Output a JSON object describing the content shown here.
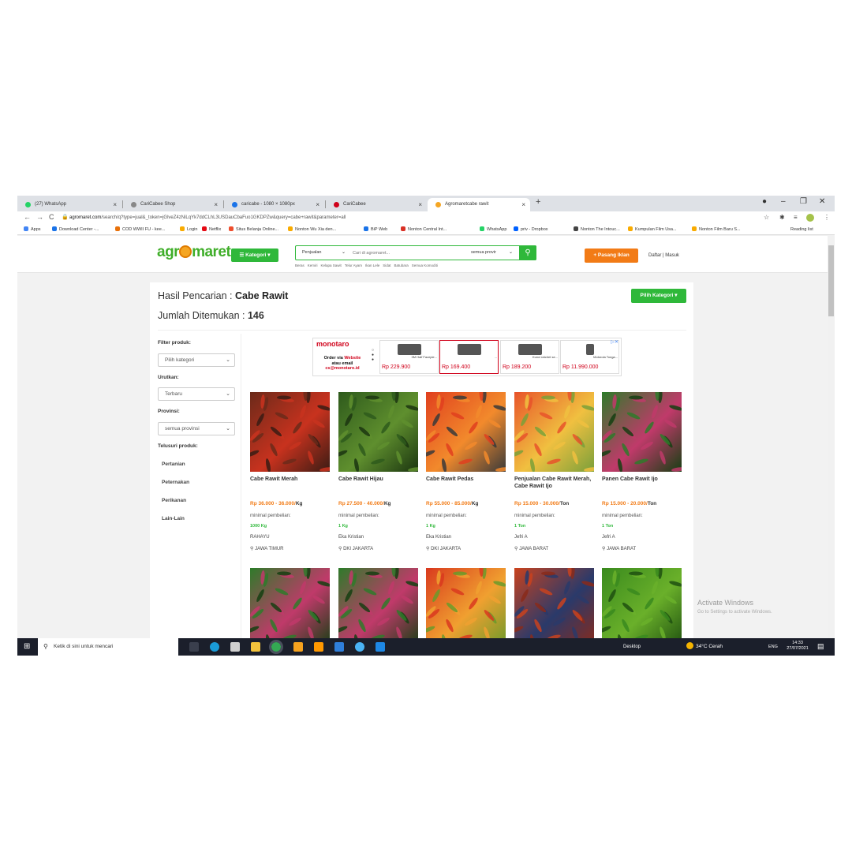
{
  "browser": {
    "tabs": [
      {
        "label": "(27) WhatsApp",
        "color": "#25d366"
      },
      {
        "label": "CariCabee Shop",
        "color": "#888888"
      },
      {
        "label": "caricabe - 1080 × 1080px",
        "color": "#1a73e8"
      },
      {
        "label": "CariCabee",
        "color": "#d0021b"
      },
      {
        "label": "Agromaretcabe rawit",
        "color": "#f5a623"
      }
    ],
    "url_domain": "agromaret.com",
    "url_path": "/search/q?type=jual&_token=jGlveZ4zNiLqYk7ddCLhL3USDauCbaFuo1GKDPZw&query=cabe+rawit&parameter=all",
    "bookmarks": [
      {
        "label": "Apps",
        "color": "#4285f4"
      },
      {
        "label": "Download Center -...",
        "color": "#1a73e8"
      },
      {
        "label": "COD WWII FU - kee...",
        "color": "#e8710a"
      },
      {
        "label": "Login",
        "color": "#f9ab00"
      },
      {
        "label": "Netflix",
        "color": "#e50914"
      },
      {
        "label": "Situs Belanja Online...",
        "color": "#ee4d2d"
      },
      {
        "label": "Nonton Wu Xia den...",
        "color": "#f9ab00"
      },
      {
        "label": "BiP Web",
        "color": "#1a73e8"
      },
      {
        "label": "Nonton Central Int...",
        "color": "#d93025"
      },
      {
        "label": "WhatsApp",
        "color": "#25d366"
      },
      {
        "label": "priv - Dropbox",
        "color": "#0061ff"
      },
      {
        "label": "Nonton The Intouc...",
        "color": "#444444"
      },
      {
        "label": "Kumpulan Film Usa...",
        "color": "#f9ab00"
      },
      {
        "label": "Nonton Film Baru S...",
        "color": "#f9ab00"
      }
    ],
    "reading_list": "Reading list"
  },
  "site": {
    "logo": "agr",
    "logo_rest": "maret",
    "kategori_btn": "☰ Kategori ▾",
    "search_type": "Penjualan",
    "search_placeholder": "Cari di agromaret...",
    "province": "semua provir",
    "quick_links": [
      "Beras",
      "Kemiri",
      "Kelapa Sawit",
      "Telur Ayam",
      "Ikan Lele",
      "Sidat",
      "Batubara",
      "Semua Komoditi"
    ],
    "pasang_btn": "+ Pasang Iklan",
    "auth": "Daftar | Masuk"
  },
  "results": {
    "title_prefix": "Hasil Pencarian : ",
    "query": "Cabe Rawit",
    "count_prefix": "Jumlah Ditemukan : ",
    "count": "146",
    "pilih_btn": "Pilih Kategori ▾"
  },
  "filters": {
    "filter_label": "Filter produk:",
    "filter_value": "Pilih kategori",
    "sort_label": "Urutkan:",
    "sort_value": "Terbaru",
    "province_label": "Provinsi:",
    "province_value": "semua provinsi",
    "browse_label": "Telusuri produk:",
    "categories": [
      "Pertanian",
      "Peternakan",
      "Perikanan",
      "Lain-Lain"
    ]
  },
  "ad": {
    "brand": "monotaro",
    "order_line1": "Order via",
    "order_web": "Website",
    "order_line2": "atau email",
    "order_email": "cs@monotaro.id",
    "items": [
      {
        "name": "3M Half Facepie...",
        "price": "Rp 229.900"
      },
      {
        "name": "...",
        "price": "Rp 169.400"
      },
      {
        "name": "Kunci ratchet se...",
        "price": "Rp 189.200"
      },
      {
        "name": "Motorola Tonga...",
        "price": "Rp 11.990.000"
      }
    ]
  },
  "products": [
    {
      "name": "Cabe Rawit Merah",
      "price": "Rp 36.000 - 36.000/",
      "unit": "Kg",
      "min_label": "minimal pembelian:",
      "min": "1000 Kg",
      "seller": "RAHAYU",
      "location": "JAWA TIMUR",
      "colors": [
        "#6b2a1a",
        "#c8321e",
        "#3a1c14"
      ]
    },
    {
      "name": "Cabe Rawit Hijau",
      "price": "Rp 27.500 - 40.000/",
      "unit": "Kg",
      "min_label": "minimal pembelian:",
      "min": "1 Kg",
      "seller": "Eka Kristian",
      "location": "DKI JAKARTA",
      "colors": [
        "#2e5a1c",
        "#5f8f2e",
        "#1b3510"
      ]
    },
    {
      "name": "Cabe Rawit Pedas",
      "price": "Rp 55.000 - 85.000/",
      "unit": "Kg",
      "min_label": "minimal pembelian:",
      "min": "1 Kg",
      "seller": "Eka Kristian",
      "location": "DKI JAKARTA",
      "colors": [
        "#e0401e",
        "#f28a2c",
        "#3a3a3a"
      ]
    },
    {
      "name": "Penjualan Cabe Rawit Merah, Cabe Rawit Ijo",
      "price": "Rp 15.000 - 30.000/",
      "unit": "Ton",
      "min_label": "minimal pembelian:",
      "min": "1 Ton",
      "seller": "Jefri A",
      "location": "JAWA BARAT",
      "colors": [
        "#e8542a",
        "#f0c040",
        "#7aa03a"
      ]
    },
    {
      "name": "Panen Cabe Rawit Ijo",
      "price": "Rp 15.000 - 20.000/",
      "unit": "Ton",
      "min_label": "minimal pembelian:",
      "min": "1 Ton",
      "seller": "Jefri A",
      "location": "JAWA BARAT",
      "colors": [
        "#2f7a2a",
        "#c03a6a",
        "#153f12"
      ]
    }
  ],
  "products_row2": [
    {
      "colors": [
        "#2f7a2a",
        "#c03a6a",
        "#153f12"
      ]
    },
    {
      "colors": [
        "#2f7a2a",
        "#c03a6a",
        "#153f12"
      ]
    },
    {
      "colors": [
        "#d93a1e",
        "#f0a030",
        "#6a9a2a"
      ]
    },
    {
      "colors": [
        "#c8421e",
        "#2a3a6a",
        "#8a2a1a"
      ]
    },
    {
      "colors": [
        "#3a8a1e",
        "#6ab02a",
        "#1f5010"
      ]
    }
  ],
  "windows": {
    "activate_title": "Activate Windows",
    "activate_sub": "Go to Settings to activate Windows.",
    "search_placeholder": "Ketik di sini untuk mencari",
    "desktop": "Desktop",
    "weather": "34°C  Cerah",
    "lang": "ENG",
    "time": "14:33",
    "date": "27/07/2021"
  }
}
